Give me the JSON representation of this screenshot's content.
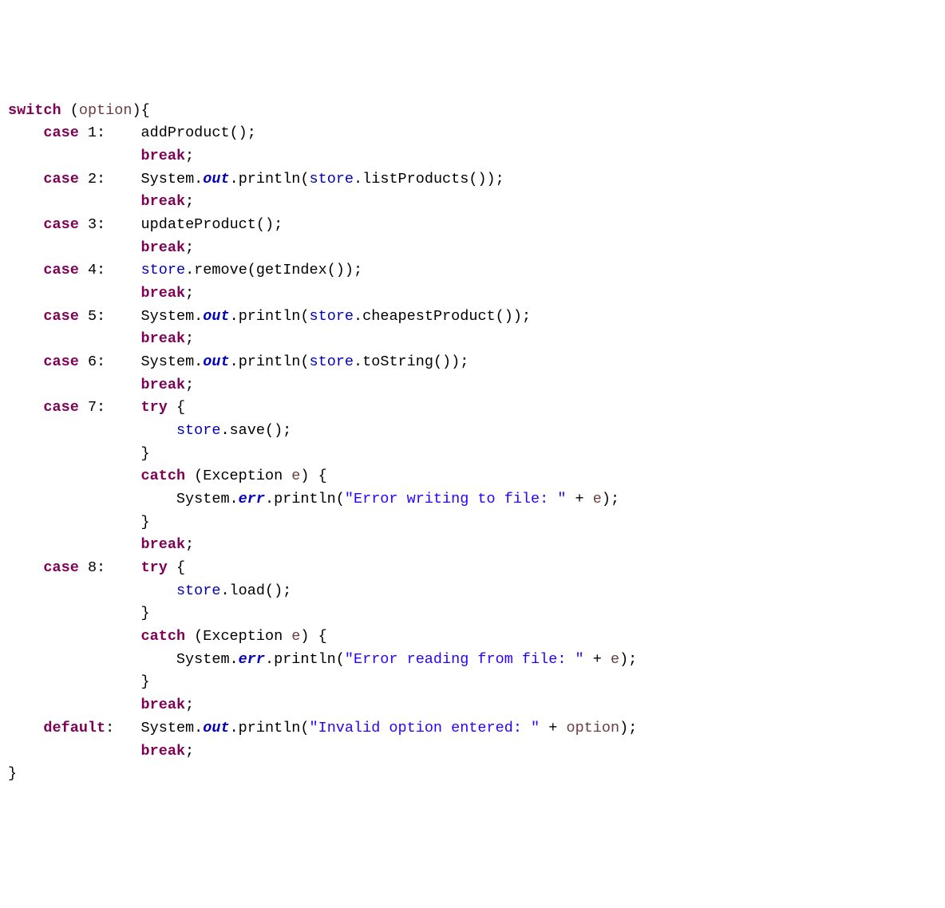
{
  "tokens": [
    {
      "cls": "kw",
      "t": "switch"
    },
    {
      "t": " ("
    },
    {
      "cls": "var",
      "t": "option"
    },
    {
      "t": "){\n"
    },
    {
      "t": "    "
    },
    {
      "cls": "kw",
      "t": "case"
    },
    {
      "t": " 1:    addProduct();\n"
    },
    {
      "t": "               "
    },
    {
      "cls": "kw",
      "t": "break"
    },
    {
      "t": ";\n"
    },
    {
      "t": "    "
    },
    {
      "cls": "kw",
      "t": "case"
    },
    {
      "t": " 2:    System."
    },
    {
      "cls": "stat",
      "t": "out"
    },
    {
      "t": ".println("
    },
    {
      "cls": "fld",
      "t": "store"
    },
    {
      "t": ".listProducts());\n"
    },
    {
      "t": "               "
    },
    {
      "cls": "kw",
      "t": "break"
    },
    {
      "t": ";\n"
    },
    {
      "t": "    "
    },
    {
      "cls": "kw",
      "t": "case"
    },
    {
      "t": " 3:    updateProduct();\n"
    },
    {
      "t": "               "
    },
    {
      "cls": "kw",
      "t": "break"
    },
    {
      "t": ";\n"
    },
    {
      "t": "    "
    },
    {
      "cls": "kw",
      "t": "case"
    },
    {
      "t": " 4:    "
    },
    {
      "cls": "fld",
      "t": "store"
    },
    {
      "t": ".remove(getIndex());\n"
    },
    {
      "t": "               "
    },
    {
      "cls": "kw",
      "t": "break"
    },
    {
      "t": ";\n"
    },
    {
      "t": "    "
    },
    {
      "cls": "kw",
      "t": "case"
    },
    {
      "t": " 5:    System."
    },
    {
      "cls": "stat",
      "t": "out"
    },
    {
      "t": ".println("
    },
    {
      "cls": "fld",
      "t": "store"
    },
    {
      "t": ".cheapestProduct());\n"
    },
    {
      "t": "               "
    },
    {
      "cls": "kw",
      "t": "break"
    },
    {
      "t": ";\n"
    },
    {
      "t": "    "
    },
    {
      "cls": "kw",
      "t": "case"
    },
    {
      "t": " 6:    System."
    },
    {
      "cls": "stat",
      "t": "out"
    },
    {
      "t": ".println("
    },
    {
      "cls": "fld",
      "t": "store"
    },
    {
      "t": ".toString());\n"
    },
    {
      "t": "               "
    },
    {
      "cls": "kw",
      "t": "break"
    },
    {
      "t": ";\n"
    },
    {
      "t": "    "
    },
    {
      "cls": "kw",
      "t": "case"
    },
    {
      "t": " 7:    "
    },
    {
      "cls": "kw",
      "t": "try"
    },
    {
      "t": " {\n"
    },
    {
      "t": "                   "
    },
    {
      "cls": "fld",
      "t": "store"
    },
    {
      "t": ".save();\n"
    },
    {
      "t": "               }\n"
    },
    {
      "t": "               "
    },
    {
      "cls": "kw",
      "t": "catch"
    },
    {
      "t": " (Exception "
    },
    {
      "cls": "var",
      "t": "e"
    },
    {
      "t": ") {\n"
    },
    {
      "t": "                   System."
    },
    {
      "cls": "stat",
      "t": "err"
    },
    {
      "t": ".println("
    },
    {
      "cls": "str",
      "t": "\"Error writing to file: \""
    },
    {
      "t": " + "
    },
    {
      "cls": "var",
      "t": "e"
    },
    {
      "t": ");\n"
    },
    {
      "t": "               }\n"
    },
    {
      "t": "               "
    },
    {
      "cls": "kw",
      "t": "break"
    },
    {
      "t": ";\n"
    },
    {
      "t": "    "
    },
    {
      "cls": "kw",
      "t": "case"
    },
    {
      "t": " 8:    "
    },
    {
      "cls": "kw",
      "t": "try"
    },
    {
      "t": " {\n"
    },
    {
      "t": "                   "
    },
    {
      "cls": "fld",
      "t": "store"
    },
    {
      "t": ".load();\n"
    },
    {
      "t": "               }\n"
    },
    {
      "t": "               "
    },
    {
      "cls": "kw",
      "t": "catch"
    },
    {
      "t": " (Exception "
    },
    {
      "cls": "var",
      "t": "e"
    },
    {
      "t": ") {\n"
    },
    {
      "t": "                   System."
    },
    {
      "cls": "stat",
      "t": "err"
    },
    {
      "t": ".println("
    },
    {
      "cls": "str",
      "t": "\"Error reading from file: \""
    },
    {
      "t": " + "
    },
    {
      "cls": "var",
      "t": "e"
    },
    {
      "t": ");\n"
    },
    {
      "t": "               }\n"
    },
    {
      "t": "               "
    },
    {
      "cls": "kw",
      "t": "break"
    },
    {
      "t": ";\n"
    },
    {
      "t": "    "
    },
    {
      "cls": "kw",
      "t": "default"
    },
    {
      "t": ":   System."
    },
    {
      "cls": "stat",
      "t": "out"
    },
    {
      "t": ".println("
    },
    {
      "cls": "str",
      "t": "\"Invalid option entered: \""
    },
    {
      "t": " + "
    },
    {
      "cls": "var",
      "t": "option"
    },
    {
      "t": ");\n"
    },
    {
      "t": "               "
    },
    {
      "cls": "kw",
      "t": "break"
    },
    {
      "t": ";\n"
    },
    {
      "t": "}"
    }
  ]
}
